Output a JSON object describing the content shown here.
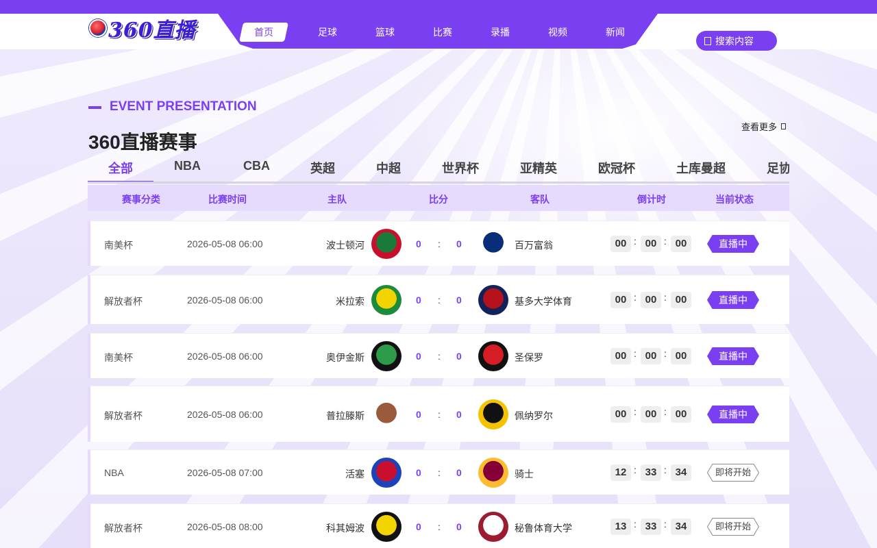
{
  "logo": {
    "text": "360直播"
  },
  "nav": [
    "首页",
    "足球",
    "篮球",
    "比赛",
    "录播",
    "视频",
    "新闻"
  ],
  "search": {
    "label": "搜索内容"
  },
  "section": {
    "en": "EVENT PRESENTATION",
    "title": "360直播赛事",
    "more": "查看更多"
  },
  "tabs": [
    "全部",
    "NBA",
    "CBA",
    "英超",
    "中超",
    "世界杯",
    "亚精英",
    "欧冠杯",
    "土库曼超",
    "足协"
  ],
  "headers": [
    "赛事分类",
    "比赛时间",
    "主队",
    "比分",
    "客队",
    "倒计时",
    "当前状态"
  ],
  "rows": [
    {
      "league": "南美杯",
      "time": "2026-05-08 06:00",
      "home": "波士顿河",
      "home_score": "0",
      "sep": ":",
      "away_score": "0",
      "away": "百万富翁",
      "cd": [
        "00",
        "00",
        "00"
      ],
      "status": "直播中",
      "live": true,
      "home_colors": [
        "#1a7a3a",
        "#c8102e"
      ],
      "away_colors": [
        "#0a2d7a",
        "#ffffff"
      ]
    },
    {
      "league": "解放者杯",
      "time": "2026-05-08 06:00",
      "home": "米拉索",
      "home_score": "0",
      "sep": ":",
      "away_score": "0",
      "away": "基多大学体育",
      "cd": [
        "00",
        "00",
        "00"
      ],
      "status": "直播中",
      "live": true,
      "home_colors": [
        "#f2d400",
        "#1c8c3c"
      ],
      "away_colors": [
        "#b5121b",
        "#12235c"
      ]
    },
    {
      "league": "南美杯",
      "time": "2026-05-08 06:00",
      "home": "奥伊金斯",
      "home_score": "0",
      "sep": ":",
      "away_score": "0",
      "away": "圣保罗",
      "cd": [
        "00",
        "00",
        "00"
      ],
      "status": "直播中",
      "live": true,
      "home_colors": [
        "#2e9b4a",
        "#111111"
      ],
      "away_colors": [
        "#d41d24",
        "#111111"
      ]
    },
    {
      "league": "解放者杯",
      "time": "2026-05-08 06:00",
      "home": "普拉滕斯",
      "home_score": "0",
      "sep": ":",
      "away_score": "0",
      "away": "佩纳罗尔",
      "cd": [
        "00",
        "00",
        "00"
      ],
      "status": "直播中",
      "live": true,
      "home_colors": [
        "#9a5a3c",
        "#ffffff"
      ],
      "away_colors": [
        "#111111",
        "#f3c300"
      ]
    },
    {
      "league": "NBA",
      "time": "2026-05-08 07:00",
      "home": "活塞",
      "home_score": "0",
      "sep": ":",
      "away_score": "0",
      "away": "骑士",
      "cd": [
        "12",
        "33",
        "34"
      ],
      "status": "即将开始",
      "live": false,
      "home_colors": [
        "#c8102e",
        "#1d42ba"
      ],
      "away_colors": [
        "#860038",
        "#fdbb30"
      ]
    },
    {
      "league": "解放者杯",
      "time": "2026-05-08 08:00",
      "home": "科其姆波",
      "home_score": "0",
      "sep": ":",
      "away_score": "0",
      "away": "秘鲁体育大学",
      "cd": [
        "13",
        "33",
        "34"
      ],
      "status": "即将开始",
      "live": false,
      "home_colors": [
        "#f2d400",
        "#111111"
      ],
      "away_colors": [
        "#ffffff",
        "#9b1b30"
      ]
    }
  ]
}
